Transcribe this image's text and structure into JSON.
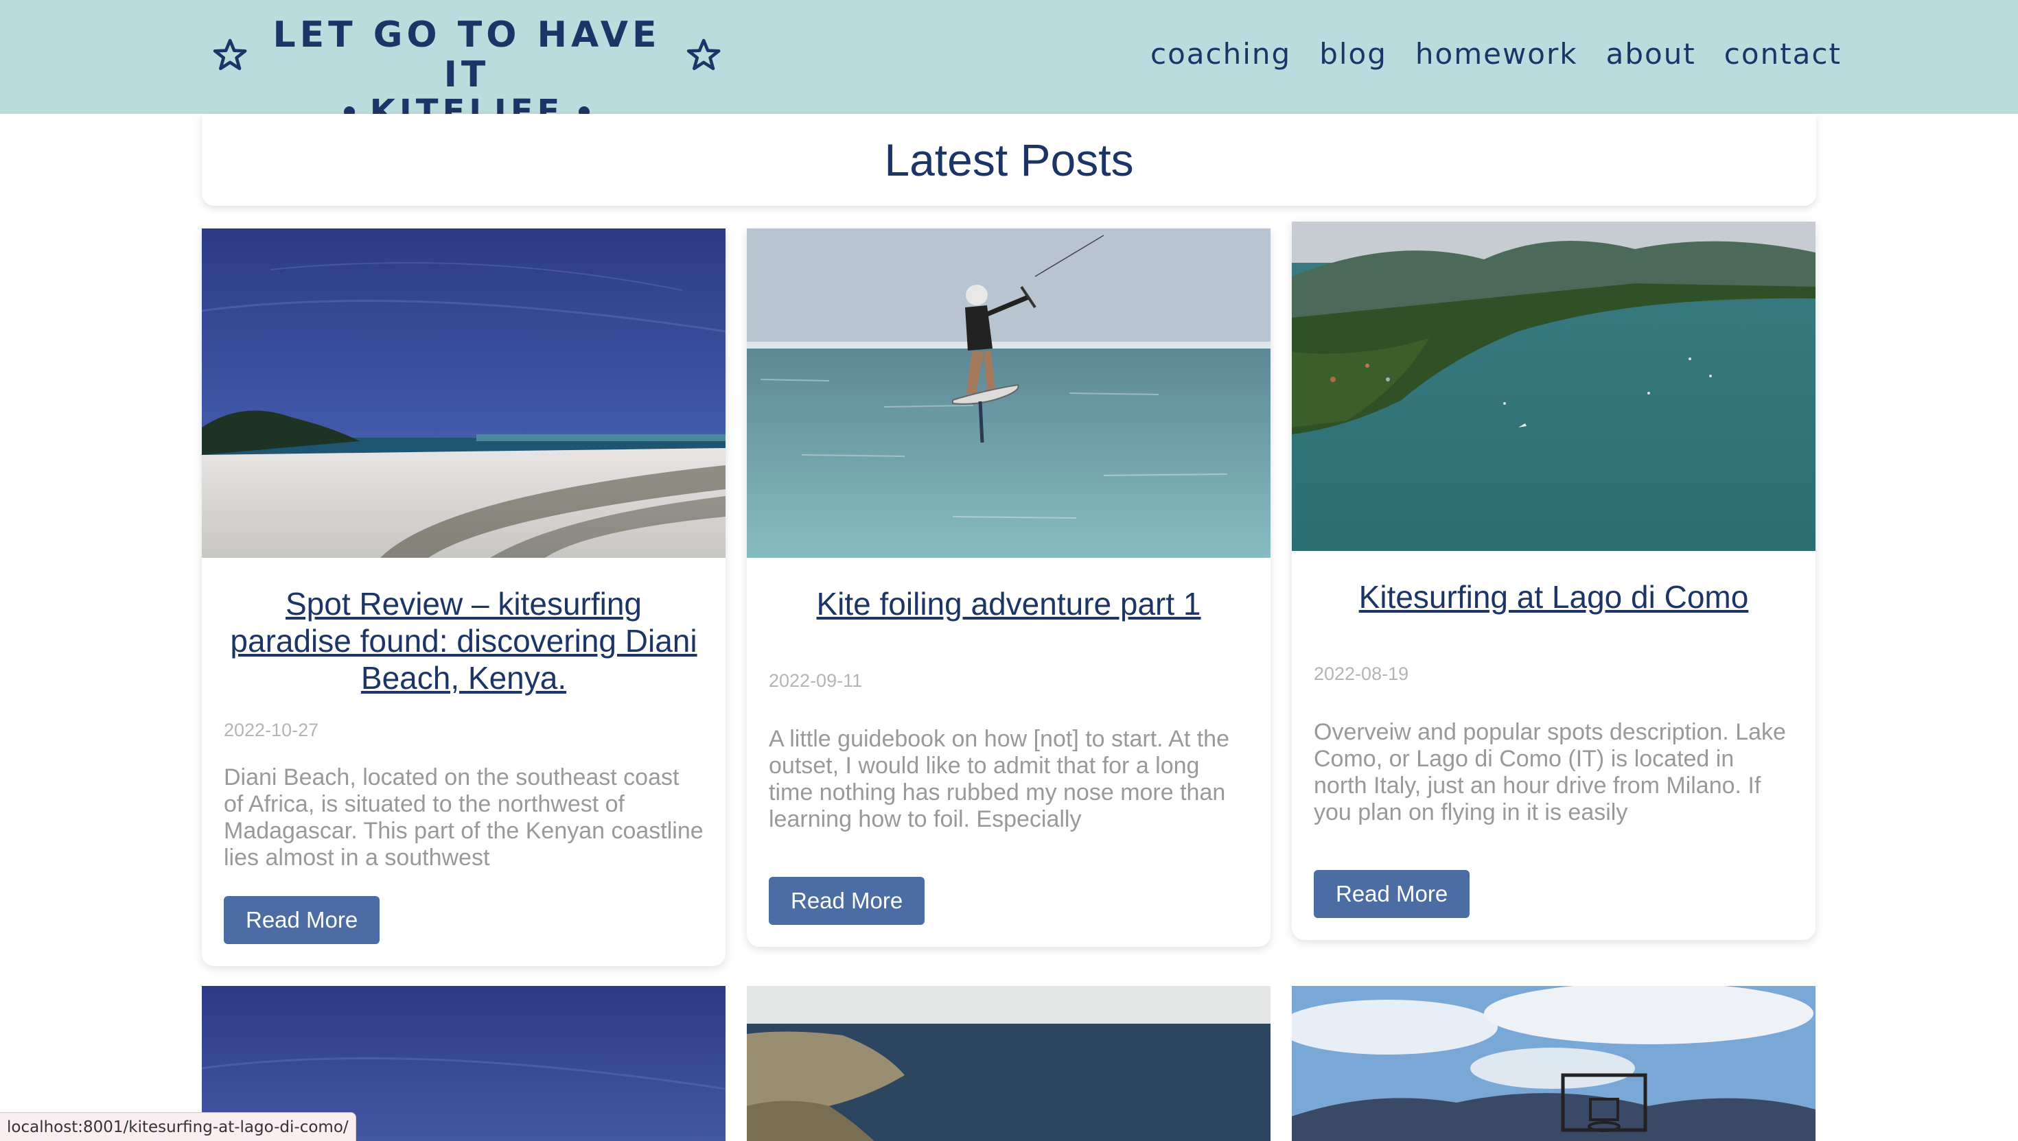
{
  "brand": {
    "line1": "LET GO TO HAVE IT",
    "line2": "KITELIFE",
    "color": "#1c3566"
  },
  "nav": {
    "items": [
      "coaching",
      "blog",
      "homework",
      "about",
      "contact"
    ]
  },
  "page": {
    "heading": "Latest Posts"
  },
  "posts": [
    {
      "title": "Spot Review – kitesurfing paradise found: discovering Diani Beach, Kenya.",
      "date": "2022-10-27",
      "excerpt": "Diani Beach, located on the southeast coast of Africa, is situated to the northwest of Madagascar. This part of the Kenyan coastline lies almost in a southwest",
      "button": "Read More"
    },
    {
      "title": "Kite foiling adventure part 1",
      "date": "2022-09-11",
      "excerpt": "A little guidebook on how [not] to start. At the outset, I would like to admit that for a long time nothing has rubbed my nose more than learning how to foil. Especially",
      "button": "Read More"
    },
    {
      "title": "Kitesurfing at Lago di Como",
      "date": "2022-08-19",
      "excerpt": "Overveiw and popular spots description. Lake Como, or Lago di Como (IT)  is located in north Italy, just an hour drive from Milano. If you plan on flying in it is easily",
      "button": "Read More"
    }
  ],
  "status_bar": {
    "url": "localhost:8001/kitesurfing-at-lago-di-como/"
  },
  "colors": {
    "header_bg": "#badcdc",
    "button_bg": "#4c6da4",
    "date_text": "#b4b4b4",
    "excerpt_text": "#999999"
  }
}
